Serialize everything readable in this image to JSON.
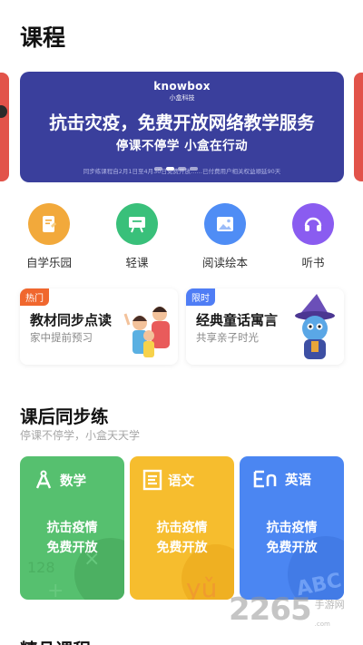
{
  "header": {
    "title": "课程"
  },
  "banner": {
    "brand_name": "knowbox",
    "brand_sub": "小盒科技",
    "headline": "抗击灾疫，免费开放网络教学服务",
    "subline": "停课不停学  小盒在行动",
    "note": "同步练课程自2月1日至4月30日免费开放……已付费用户相关权益顺延90天",
    "dot_count": 4,
    "active_dot": 1,
    "colors": {
      "bg": "#3a3f9c",
      "peek": "#e2534a"
    }
  },
  "quick_entries": [
    {
      "label": "自学乐园",
      "icon": "book-pencil-icon",
      "color": "#f2a93b"
    },
    {
      "label": "轻课",
      "icon": "easel-board-icon",
      "color": "#39c07a"
    },
    {
      "label": "阅读绘本",
      "icon": "picture-book-icon",
      "color": "#4f8df5"
    },
    {
      "label": "听书",
      "icon": "headphones-icon",
      "color": "#8a5cf0"
    }
  ],
  "promos": [
    {
      "badge": "热门",
      "badge_color": "#f0672e",
      "title": "教材同步点读",
      "subtitle": "家中提前预习",
      "image": "family-illustration"
    },
    {
      "badge": "限时",
      "badge_color": "#4f7df5",
      "title": "经典童话寓言",
      "subtitle": "共享亲子时光",
      "image": "wizard-illustration"
    }
  ],
  "section": {
    "title": "课后同步练",
    "subtitle": "停课不停学，小盒天天学",
    "subjects": [
      {
        "name": "数学",
        "icon": "math-compass-icon",
        "line1": "抗击疫情",
        "line2": "免费开放",
        "color": "#56c06f"
      },
      {
        "name": "语文",
        "icon": "chinese-char-icon",
        "line1": "抗击疫情",
        "line2": "免费开放",
        "color": "#f6bd2e"
      },
      {
        "name": "英语",
        "icon": "english-en-icon",
        "line1": "抗击疫情",
        "line2": "免费开放",
        "color": "#4b86f2"
      }
    ]
  },
  "next_section": {
    "title": "精品课程"
  },
  "watermark": {
    "number": "2265",
    "suffix": ".com",
    "label": "手游网"
  }
}
